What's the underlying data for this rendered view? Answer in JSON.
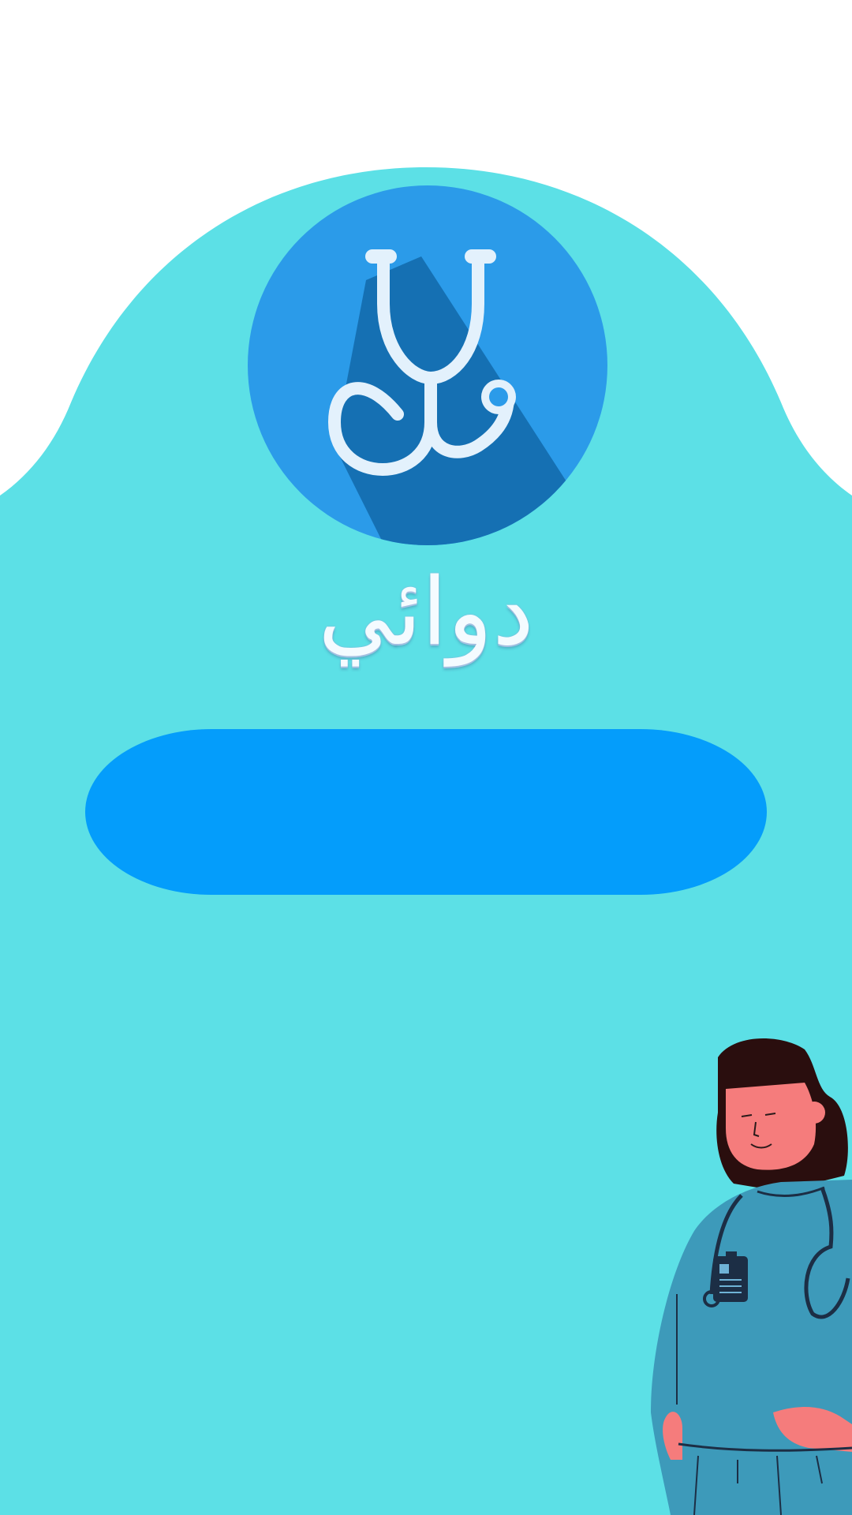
{
  "app": {
    "name": "دوائي"
  },
  "actions": {
    "primary_button_label": ""
  },
  "icons": {
    "logo": "stethoscope-icon",
    "illustration": "doctor-illustration"
  },
  "colors": {
    "background_top": "#ffffff",
    "background_shape": "#5ce0e6",
    "logo_circle": "#2b9be9",
    "logo_shadow": "#1570b3",
    "stethoscope": "#e3f1fc",
    "stethoscope_dot": "#2b9be9",
    "app_name": "#f4fbff",
    "primary_button": "#049dfb"
  }
}
